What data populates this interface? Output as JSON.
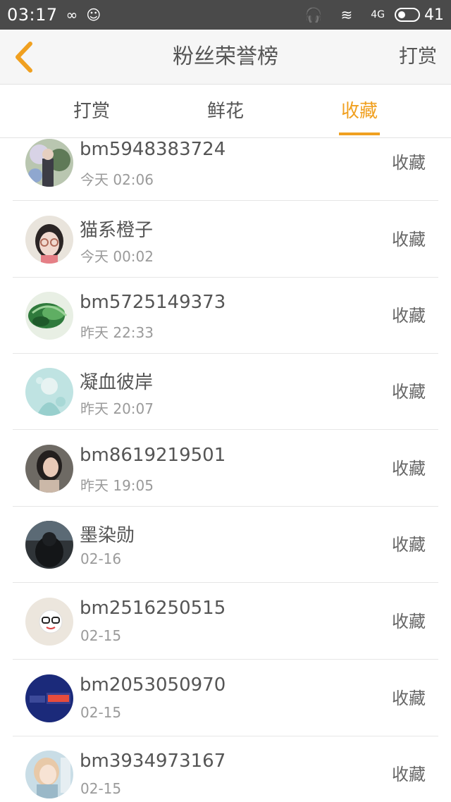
{
  "status_bar": {
    "time": "03:17",
    "battery": "41",
    "network": "4G"
  },
  "header": {
    "title": "粉丝荣誉榜",
    "action": "打赏",
    "back_icon": "chevron-left-icon"
  },
  "tabs": [
    {
      "label": "打赏",
      "active": false
    },
    {
      "label": "鲜花",
      "active": false
    },
    {
      "label": "收藏",
      "active": true
    }
  ],
  "accent_color": "#f0a020",
  "list": [
    {
      "name": "bm5948383724",
      "time": "今天 02:06",
      "tag": "收藏",
      "avatar": "flowers-photo"
    },
    {
      "name": "猫系橙子",
      "time": "今天 00:02",
      "tag": "收藏",
      "avatar": "girl-glasses-photo"
    },
    {
      "name": "bm5725149373",
      "time": "昨天 22:33",
      "tag": "收藏",
      "avatar": "green-plant-photo"
    },
    {
      "name": "凝血彼岸",
      "time": "昨天 20:07",
      "tag": "收藏",
      "avatar": "teal-illustration"
    },
    {
      "name": "bm8619219501",
      "time": "昨天 19:05",
      "tag": "收藏",
      "avatar": "woman-portrait-photo"
    },
    {
      "name": "墨染勋",
      "time": "02-16",
      "tag": "收藏",
      "avatar": "dark-hood-photo"
    },
    {
      "name": "bm2516250515",
      "time": "02-15",
      "tag": "收藏",
      "avatar": "cartoon-glasses-photo"
    },
    {
      "name": "bm2053050970",
      "time": "02-15",
      "tag": "收藏",
      "avatar": "navy-text-logo"
    },
    {
      "name": "bm3934973167",
      "time": "02-15",
      "tag": "收藏",
      "avatar": "anime-girl-photo"
    }
  ]
}
